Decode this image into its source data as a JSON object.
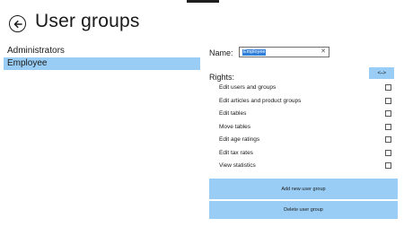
{
  "page": {
    "title": "User groups"
  },
  "groups": [
    {
      "label": "Administrators",
      "selected": false
    },
    {
      "label": "Employee",
      "selected": true
    }
  ],
  "form": {
    "name_label": "Name:",
    "name_value": "Employee",
    "rights_label": "Rights:",
    "swap_label": "<-->"
  },
  "rights": [
    {
      "label": "Edit users and groups",
      "checked": false
    },
    {
      "label": "Edit articles and product groups",
      "checked": false
    },
    {
      "label": "Edit tables",
      "checked": false
    },
    {
      "label": "Move tables",
      "checked": false
    },
    {
      "label": "Edit age ratings",
      "checked": false
    },
    {
      "label": "Edit tax rates",
      "checked": false
    },
    {
      "label": "View statistics",
      "checked": false
    }
  ],
  "actions": {
    "add_label": "Add new user group",
    "delete_label": "Delete user group"
  },
  "icons": {
    "back": "back-arrow-icon",
    "clear": "clear-x-icon"
  },
  "colors": {
    "accent": "#99cdf5",
    "selection": "#2f7ed8"
  }
}
